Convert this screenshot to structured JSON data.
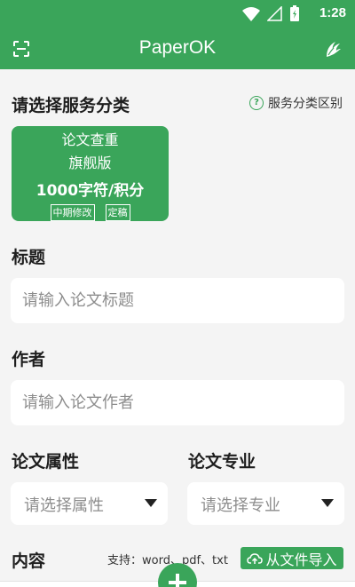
{
  "status": {
    "time": "1:28"
  },
  "appbar": {
    "title": "PaperOK"
  },
  "service": {
    "label": "请选择服务分类",
    "help_link": "服务分类区别",
    "card": {
      "line1": "论文查重",
      "line2": "旗舰版",
      "price": "1000字符/积分",
      "tags": [
        "中期修改",
        "定稿"
      ]
    }
  },
  "title_field": {
    "label": "标题",
    "placeholder": "请输入论文标题"
  },
  "author_field": {
    "label": "作者",
    "placeholder": "请输入论文作者"
  },
  "attribute": {
    "label": "论文属性",
    "placeholder": "请选择属性"
  },
  "major": {
    "label": "论文专业",
    "placeholder": "请选择专业"
  },
  "content": {
    "label": "内容",
    "support": "支持：word、pdf、txt",
    "import_label": "从文件导入"
  },
  "colors": {
    "brand": "#3aa55a",
    "background": "#f4f4f4"
  }
}
